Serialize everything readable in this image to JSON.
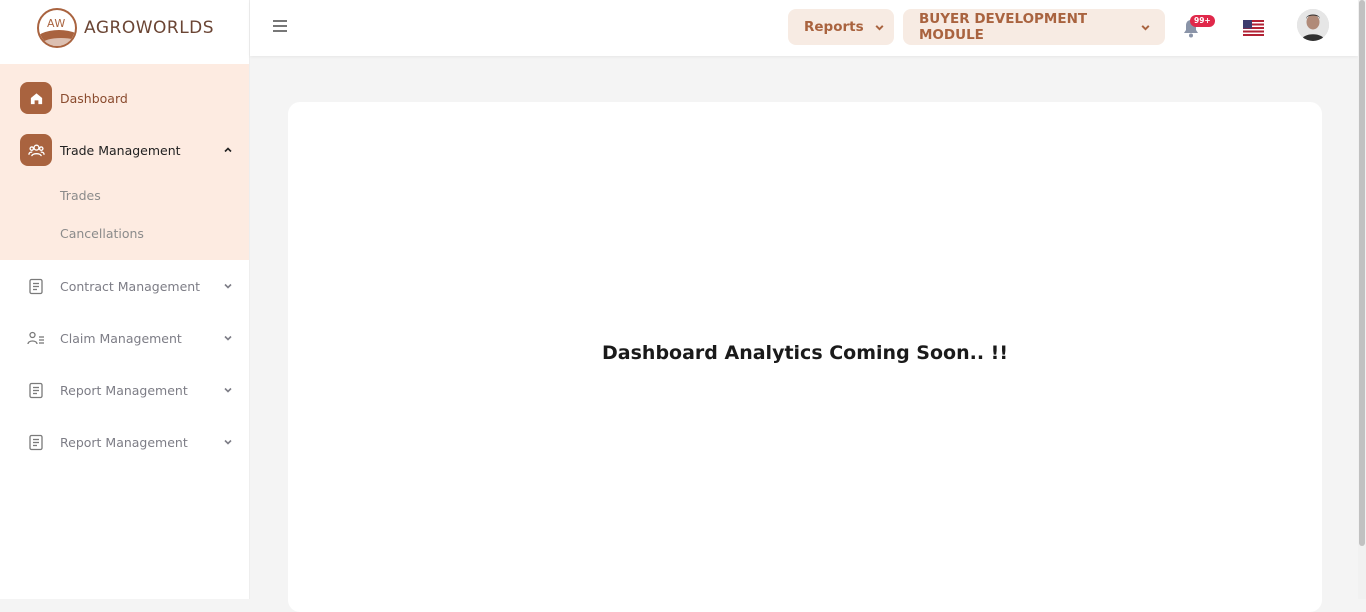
{
  "brand": {
    "logo_text": "AW",
    "name": "AGROWORLDS"
  },
  "sidebar": {
    "items": [
      {
        "label": "Dashboard",
        "icon": "home-icon"
      },
      {
        "label": "Trade Management",
        "icon": "users-icon",
        "children": [
          "Trades",
          "Cancellations"
        ]
      },
      {
        "label": "Contract Management",
        "icon": "document-icon"
      },
      {
        "label": "Claim Management",
        "icon": "user-list-icon"
      },
      {
        "label": "Report Management",
        "icon": "document-icon"
      },
      {
        "label": "Report Management",
        "icon": "document-icon"
      }
    ]
  },
  "topbar": {
    "reports_label": "Reports",
    "module_label": "BUYER DEVELOPMENT MODULE",
    "notification_badge": "99+"
  },
  "main": {
    "message": "Dashboard Analytics Coming Soon.. !!"
  },
  "colors": {
    "accent": "#a9633f",
    "active_bg": "#fdebe1",
    "pill_bg": "#f7ebe3",
    "badge": "#e0284a"
  }
}
